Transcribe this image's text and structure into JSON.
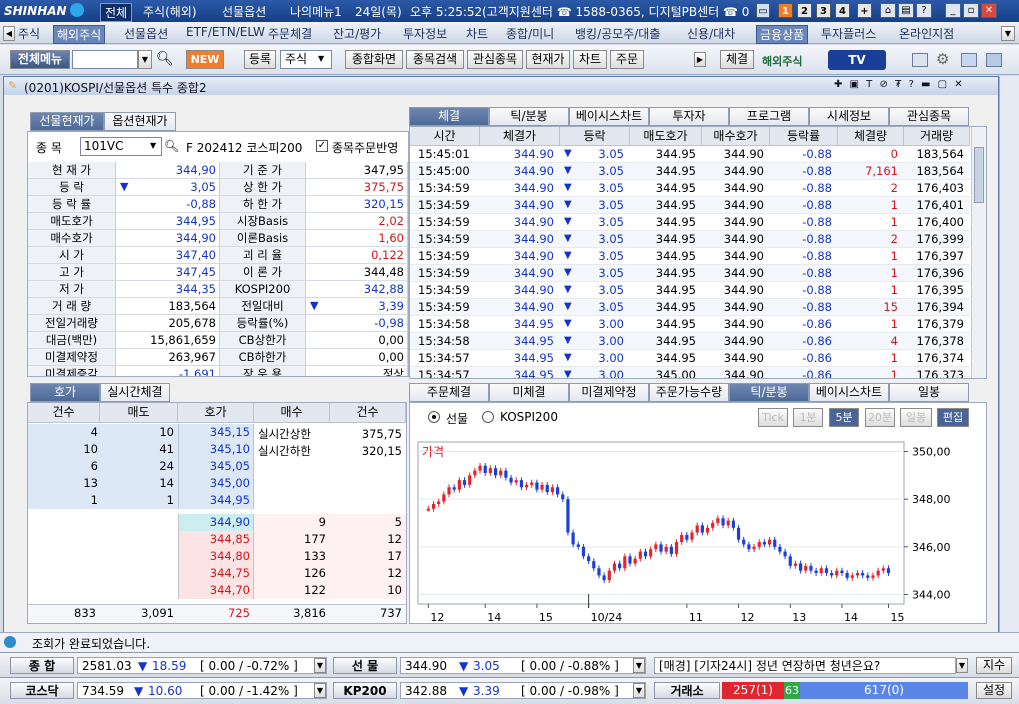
{
  "title_bar": {
    "logo": "SHINHAN",
    "menus": [
      "전체",
      "주식(해외)",
      "선물옵션",
      "나의메뉴1"
    ],
    "date": "24일(목)",
    "time": "오후 5:25:52",
    "contact1": "(고객지원센터 ☎ 1588-0365, 디지털PB센터 ☎ 0",
    "nums": [
      "1",
      "2",
      "3",
      "4"
    ]
  },
  "menu_bar": {
    "items": [
      "주식",
      "해외주식",
      "선물옵션",
      "ETF/ETN/ELW",
      "주문체결",
      "잔고/평가",
      "투자정보",
      "차트",
      "종합/미니",
      "뱅킹/공모주/대출",
      "신용/대차",
      "금융상품",
      "투자플러스",
      "온라인지점"
    ]
  },
  "toolbar": {
    "menu_label": "전체메뉴",
    "new_badge": "NEW",
    "register": "등록",
    "stock": "주식",
    "buttons": [
      "종합화면",
      "종목검색",
      "관심종목",
      "현재가",
      "차트",
      "주문"
    ],
    "execution": "체결",
    "overseas": "해외주식",
    "tv": "TV"
  },
  "window": {
    "title": "(0201)KOSPI/선물옵션 특수 종합2"
  },
  "left_tabs": [
    "선물현재가",
    "옵션현재가"
  ],
  "symbol": {
    "label": "종  목",
    "code": "101VC",
    "name": "F 202412 코스피200",
    "reflect": "종목주문반영"
  },
  "quote_rows": [
    {
      "l1": "현 재 가",
      "v1": "344,90",
      "c1": "blue",
      "l2": "기 준 가",
      "v2": "347,95",
      "c2": ""
    },
    {
      "l1": "등   락",
      "v1": "3,05",
      "c1": "blue",
      "arrow": "▼",
      "l2": "상 한 가",
      "v2": "375,75",
      "c2": "red"
    },
    {
      "l1": "등 락 률",
      "v1": "-0,88",
      "c1": "blue",
      "l2": "하 한 가",
      "v2": "320,15",
      "c2": "blue"
    },
    {
      "l1": "매도호가",
      "v1": "344,95",
      "c1": "blue",
      "l2": "시장Basis",
      "v2": "2,02",
      "c2": "red"
    },
    {
      "l1": "매수호가",
      "v1": "344,90",
      "c1": "blue",
      "l2": "이론Basis",
      "v2": "1,60",
      "c2": "red"
    },
    {
      "l1": "시   가",
      "v1": "347,40",
      "c1": "blue",
      "l2": "괴 리 율",
      "v2": "0,122",
      "c2": "red"
    },
    {
      "l1": "고   가",
      "v1": "347,45",
      "c1": "blue",
      "l2": "이 론 가",
      "v2": "344,48",
      "c2": ""
    },
    {
      "l1": "저   가",
      "v1": "344,35",
      "c1": "blue",
      "l2": "KOSPI200",
      "v2": "342,88",
      "c2": "blue"
    },
    {
      "l1": "거 래 량",
      "v1": "183,564",
      "c1": "",
      "l2": "전일대비",
      "v2": "3,39",
      "c2": "blue",
      "arrow2": "▼"
    },
    {
      "l1": "전일거래량",
      "v1": "205,678",
      "c1": "",
      "l2": "등락률(%)",
      "v2": "-0,98",
      "c2": "blue"
    },
    {
      "l1": "대금(백만)",
      "v1": "15,861,659",
      "c1": "",
      "l2": "CB상한가",
      "v2": "0,00",
      "c2": ""
    },
    {
      "l1": "미결제약정",
      "v1": "263,967",
      "c1": "",
      "l2": "CB하한가",
      "v2": "0,00",
      "c2": ""
    },
    {
      "l1": "미결제증감",
      "v1": "-1,691",
      "c1": "blue",
      "l2": "장 운 용",
      "v2": "정상",
      "c2": ""
    }
  ],
  "right_tabs": [
    "체결",
    "틱/분봉",
    "베이시스차트",
    "투자자",
    "프로그램",
    "시세정보",
    "관심종목"
  ],
  "trade_headers": [
    "시간",
    "체결가",
    "등락",
    "매도호가",
    "매수호가",
    "등락률",
    "체결량",
    "거래량"
  ],
  "trades": [
    [
      "15:45:01",
      "344.90",
      "3.05",
      "344.95",
      "344.90",
      "-0.88",
      "0",
      "183,564"
    ],
    [
      "15:45:00",
      "344.90",
      "3.05",
      "344.95",
      "344.90",
      "-0.88",
      "7,161",
      "183,564"
    ],
    [
      "15:34:59",
      "344.90",
      "3.05",
      "344.95",
      "344.90",
      "-0.88",
      "2",
      "176,403"
    ],
    [
      "15:34:59",
      "344.90",
      "3.05",
      "344.95",
      "344.90",
      "-0.88",
      "1",
      "176,401"
    ],
    [
      "15:34:59",
      "344.90",
      "3.05",
      "344.95",
      "344.90",
      "-0.88",
      "1",
      "176,400"
    ],
    [
      "15:34:59",
      "344.90",
      "3.05",
      "344.95",
      "344.90",
      "-0.88",
      "2",
      "176,399"
    ],
    [
      "15:34:59",
      "344.90",
      "3.05",
      "344.95",
      "344.90",
      "-0.88",
      "1",
      "176,397"
    ],
    [
      "15:34:59",
      "344.90",
      "3.05",
      "344.95",
      "344.90",
      "-0.88",
      "1",
      "176,396"
    ],
    [
      "15:34:59",
      "344.90",
      "3.05",
      "344.95",
      "344.90",
      "-0.88",
      "1",
      "176,395"
    ],
    [
      "15:34:59",
      "344.90",
      "3.05",
      "344.95",
      "344.90",
      "-0.88",
      "15",
      "176,394"
    ],
    [
      "15:34:58",
      "344.95",
      "3.00",
      "344.95",
      "344.90",
      "-0.86",
      "1",
      "176,379"
    ],
    [
      "15:34:58",
      "344.95",
      "3.00",
      "344.95",
      "344.90",
      "-0.86",
      "4",
      "176,378"
    ],
    [
      "15:34:57",
      "344.95",
      "3.00",
      "344.95",
      "344.90",
      "-0.86",
      "1",
      "176,374"
    ],
    [
      "15:34:57",
      "344.95",
      "3.00",
      "345.00",
      "344.90",
      "-0.86",
      "1",
      "176,373"
    ]
  ],
  "ob_tabs": [
    "호가",
    "실시간체결"
  ],
  "ob_headers": [
    "건수",
    "매도",
    "호가",
    "매수",
    "건수"
  ],
  "ob_asks": [
    [
      "4",
      "10",
      "345,15"
    ],
    [
      "10",
      "41",
      "345,10"
    ],
    [
      "6",
      "24",
      "345,05"
    ],
    [
      "13",
      "14",
      "345,00"
    ],
    [
      "1",
      "1",
      "344,95"
    ]
  ],
  "ob_bids": [
    [
      "344,90",
      "9",
      "5"
    ],
    [
      "344,85",
      "177",
      "12"
    ],
    [
      "344,80",
      "133",
      "17"
    ],
    [
      "344,75",
      "126",
      "12"
    ],
    [
      "344,70",
      "122",
      "10"
    ]
  ],
  "ob_info": [
    [
      "실시간상한",
      "375,75"
    ],
    [
      "실시간하한",
      "320,15"
    ]
  ],
  "ob_totals": [
    "833",
    "3,091",
    "725",
    "3,816",
    "737"
  ],
  "chart_tabs": [
    "주문체결",
    "미체결",
    "미결제약정",
    "주문가능수량",
    "틱/분봉",
    "베이시스차트",
    "일봉"
  ],
  "chart_options": {
    "radio1": "선물",
    "radio2": "KOSPI200",
    "intervals": [
      "Tick",
      "1분",
      "5분",
      "20분",
      "일봉"
    ],
    "edit": "편집"
  },
  "chart_data": {
    "type": "candlestick",
    "label": "가격",
    "y_ticks": [
      "350,00",
      "348,00",
      "346,00",
      "344,00"
    ],
    "ylim": [
      343.6,
      350.4
    ],
    "x_ticks": [
      "12",
      "14",
      "15",
      "10/24",
      "11",
      "12",
      "13",
      "14",
      "15"
    ],
    "closes": [
      347.6,
      347.8,
      347.9,
      348.2,
      348.5,
      348.4,
      348.8,
      348.6,
      349.0,
      349.2,
      349.4,
      349.1,
      349.3,
      349.0,
      349.2,
      348.9,
      348.7,
      348.8,
      348.5,
      348.6,
      348.7,
      348.4,
      348.6,
      348.3,
      348.5,
      348.2,
      348.0,
      346.6,
      346.1,
      346.0,
      345.6,
      345.4,
      345.1,
      344.8,
      344.6,
      345.0,
      345.3,
      345.1,
      345.6,
      345.3,
      345.5,
      345.8,
      345.6,
      345.9,
      346.1,
      345.8,
      346.0,
      345.7,
      346.2,
      346.5,
      346.3,
      346.6,
      346.9,
      346.6,
      346.8,
      347.0,
      347.2,
      346.9,
      347.1,
      346.8,
      346.3,
      346.1,
      345.9,
      346.0,
      346.2,
      346.1,
      346.3,
      346.0,
      345.8,
      345.6,
      345.2,
      345.3,
      345.0,
      345.2,
      345.0,
      344.9,
      345.1,
      344.9,
      344.8,
      345.0,
      344.9,
      344.7,
      344.8,
      344.9,
      344.8,
      344.7,
      344.8,
      345.0,
      345.1,
      344.9
    ]
  },
  "status": "조회가 완료되었습니다.",
  "bottom": {
    "r1": {
      "label1": "종  합",
      "v1": "2581.03",
      "c1": "18.59",
      "p1": "[ 0.00   / -0.72% ]",
      "label2": "선  물",
      "v2": "344.90",
      "c2": "3.05",
      "p2": "[ 0.00   / -0.88% ]",
      "news": "[매경] [기자24시] 정년 연장하면 청년은요?",
      "btn": "지수"
    },
    "r2": {
      "label1": "코스닥",
      "v1": "734.59",
      "c1": "10.60",
      "p1": "[ 0.00   / -1.42% ]",
      "label2": "KP200",
      "v2": "342.88",
      "c2": "3.39",
      "p2": "[ 0.00   / -0.98% ]",
      "label3": "거래소",
      "up": "257(1)",
      "flat": "63",
      "down": "617(0)",
      "btn": "설정"
    }
  },
  "colors": {
    "up": "#d4141c",
    "down": "#1533c8",
    "accent": "#4f6a98"
  }
}
